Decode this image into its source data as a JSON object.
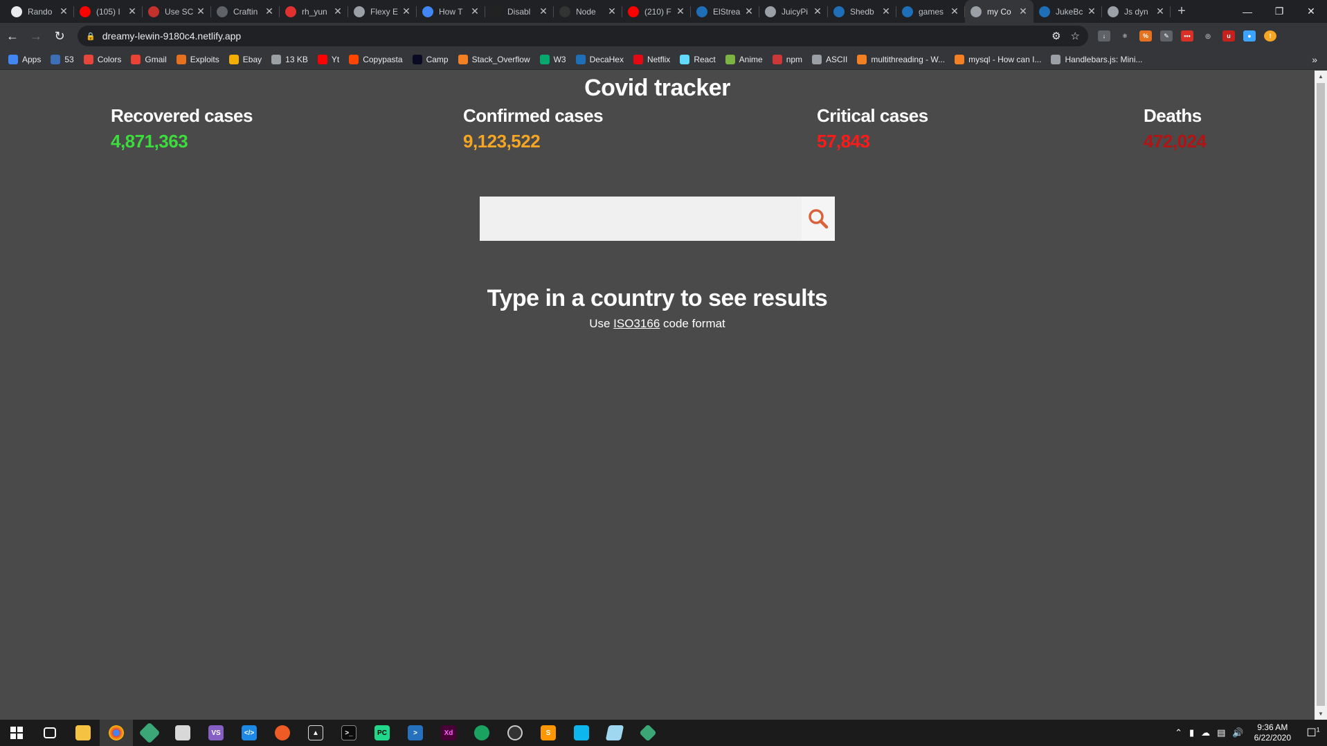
{
  "browser": {
    "tabs": [
      {
        "title": "Rando",
        "color": "#e8eaed"
      },
      {
        "title": "(105) I",
        "color": "#ff0000"
      },
      {
        "title": "Use SC",
        "color": "#c4302b"
      },
      {
        "title": "Craftin",
        "color": "#5f6368"
      },
      {
        "title": "rh_yun",
        "color": "#e03030"
      },
      {
        "title": "Flexy E",
        "color": "#9aa0a6"
      },
      {
        "title": "How T",
        "color": "#4285f4"
      },
      {
        "title": "Disabl",
        "color": "#222222"
      },
      {
        "title": "Node",
        "color": "#333333"
      },
      {
        "title": "(210) F",
        "color": "#ff0000"
      },
      {
        "title": "ElStrea",
        "color": "#1e6fb8"
      },
      {
        "title": "JuicyPi",
        "color": "#9aa0a6"
      },
      {
        "title": "Shedb",
        "color": "#1e6fb8"
      },
      {
        "title": "games",
        "color": "#1e6fb8"
      },
      {
        "title": "my Co",
        "color": "#9aa0a6",
        "active": true
      },
      {
        "title": "JukeBc",
        "color": "#1e6fb8"
      },
      {
        "title": "Js dyn",
        "color": "#9aa0a6"
      }
    ],
    "url": "dreamy-lewin-9180c4.netlify.app",
    "bookmarks": [
      {
        "label": "Apps",
        "color": "#4285f4"
      },
      {
        "label": "53",
        "color": "#3b6fb6"
      },
      {
        "label": "Colors",
        "color": "#e8453c"
      },
      {
        "label": "Gmail",
        "color": "#ea4335"
      },
      {
        "label": "Exploits",
        "color": "#e5711f"
      },
      {
        "label": "Ebay",
        "color": "#f5af02"
      },
      {
        "label": "13 KB",
        "color": "#9aa0a6"
      },
      {
        "label": "Yt",
        "color": "#ff0000"
      },
      {
        "label": "Copypasta",
        "color": "#ff4500"
      },
      {
        "label": "Camp",
        "color": "#0a0a23"
      },
      {
        "label": "Stack_Overflow",
        "color": "#f48024"
      },
      {
        "label": "W3",
        "color": "#04aa6d"
      },
      {
        "label": "DecaHex",
        "color": "#1e6fb8"
      },
      {
        "label": "Netflix",
        "color": "#e50914"
      },
      {
        "label": "React",
        "color": "#61dafb"
      },
      {
        "label": "Anime",
        "color": "#7cb342"
      },
      {
        "label": "npm",
        "color": "#cb3837"
      },
      {
        "label": "ASCII",
        "color": "#9aa0a6"
      },
      {
        "label": "multithreading - W...",
        "color": "#f48024"
      },
      {
        "label": "mysql - How can I...",
        "color": "#f48024"
      },
      {
        "label": "Handlebars.js: Mini...",
        "color": "#9aa0a6"
      }
    ],
    "more_bookmarks": "»"
  },
  "app": {
    "title": "Covid tracker",
    "stats": {
      "recovered": {
        "label": "Recovered cases",
        "value": "4,871,363",
        "color": "#3ddc3d"
      },
      "confirmed": {
        "label": "Confirmed cases",
        "value": "9,123,522",
        "color": "#f5a623"
      },
      "critical": {
        "label": "Critical cases",
        "value": "57,843",
        "color": "#ff1a1a"
      },
      "deaths": {
        "label": "Deaths",
        "value": "472,024",
        "color": "#b01414"
      }
    },
    "search": {
      "value": "",
      "placeholder": "",
      "icon": "magnifier-icon",
      "icon_color": "#d9623b"
    },
    "prompt": "Type in a country to see results",
    "hint_prefix": "Use",
    "hint_link": "ISO3166",
    "hint_suffix": "code format"
  },
  "taskbar": {
    "time": "9:36 AM",
    "date": "6/22/2020",
    "notification_count": "1"
  }
}
